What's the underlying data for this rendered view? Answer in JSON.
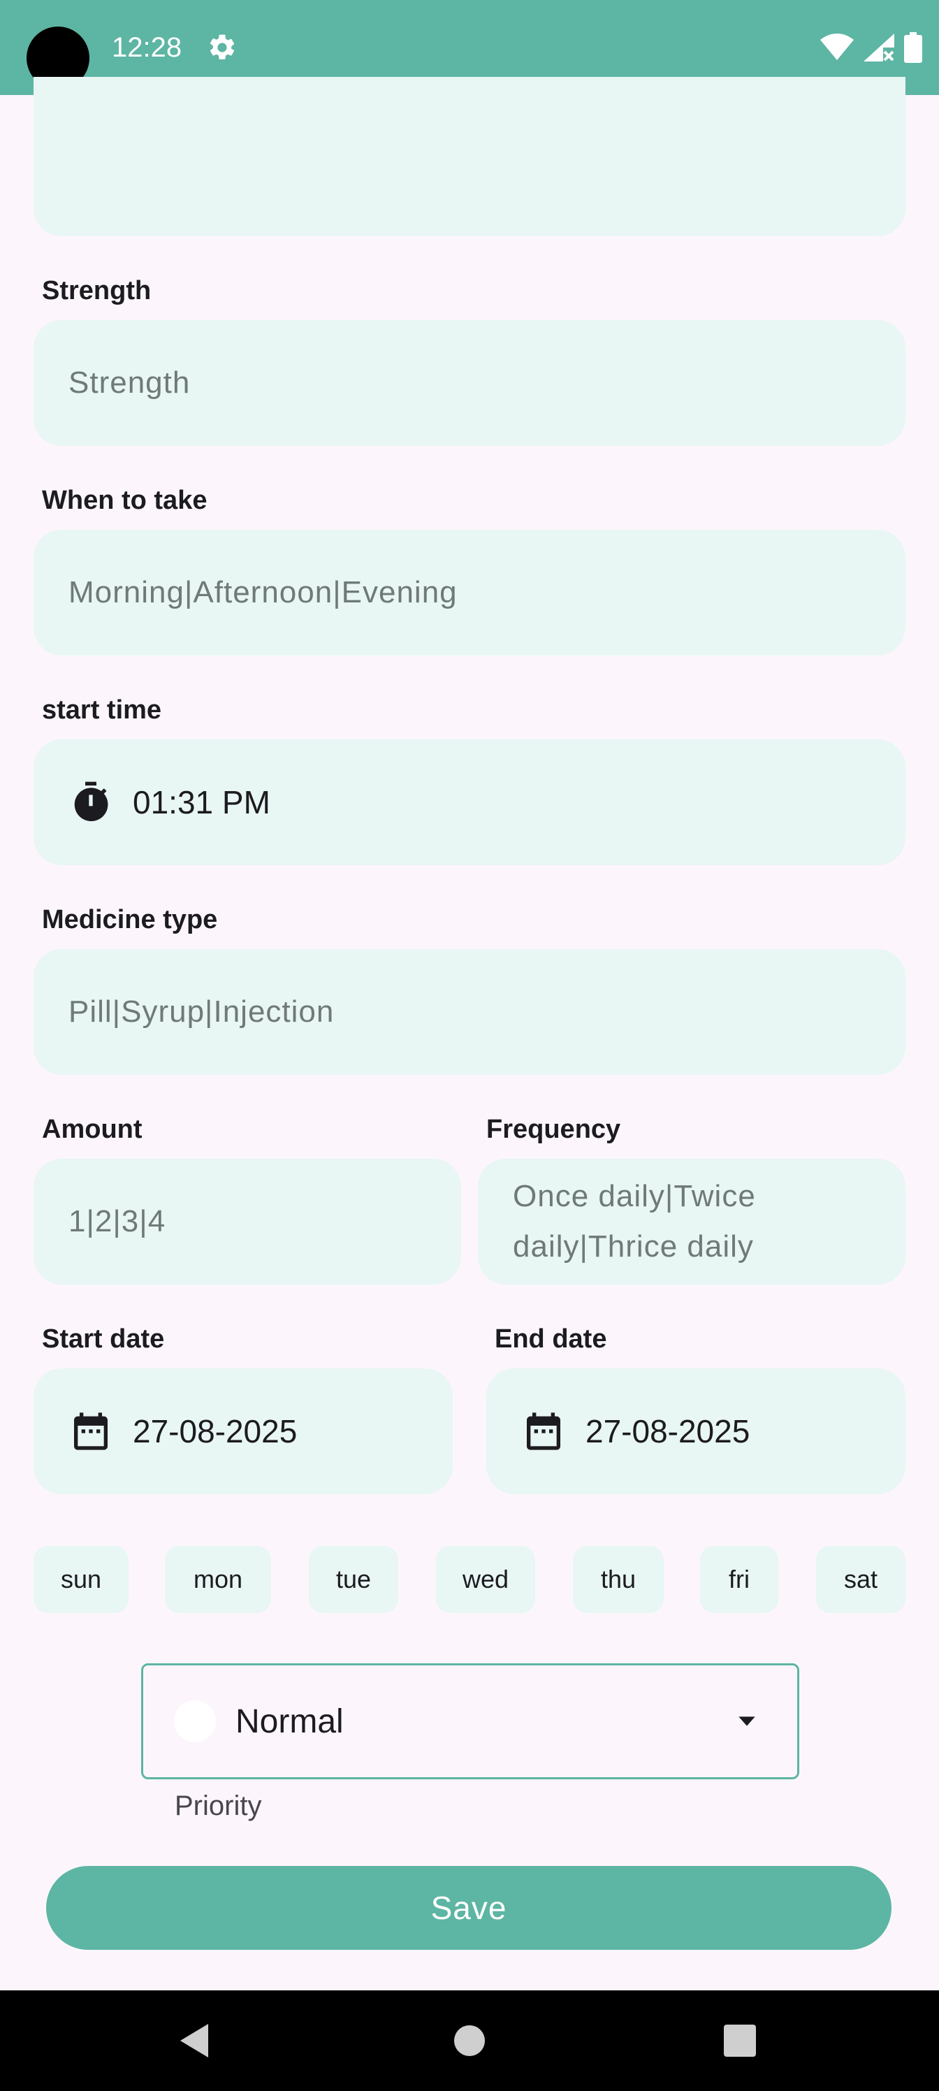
{
  "status_bar": {
    "time": "12:28",
    "icons": [
      "gear-icon",
      "wifi-icon",
      "signal-icon",
      "battery-icon"
    ]
  },
  "form": {
    "strength": {
      "label": "Strength",
      "placeholder": "Strength"
    },
    "when_to_take": {
      "label": "When to take",
      "placeholder": "Morning|Afternoon|Evening"
    },
    "start_time": {
      "label": "start time",
      "value": "01:31 PM"
    },
    "medicine_type": {
      "label": "Medicine type",
      "placeholder": "Pill|Syrup|Injection"
    },
    "amount": {
      "label": "Amount",
      "placeholder": "1|2|3|4"
    },
    "frequency": {
      "label": "Frequency",
      "placeholder_line1": "Once daily|Twice",
      "placeholder_line2": "daily|Thrice daily"
    },
    "start_date": {
      "label": "Start date",
      "value": "27-08-2025"
    },
    "end_date": {
      "label": "End date",
      "value": "27-08-2025"
    },
    "days": [
      "sun",
      "mon",
      "tue",
      "wed",
      "thu",
      "fri",
      "sat"
    ],
    "priority": {
      "value": "Normal",
      "label": "Priority"
    },
    "save_label": "Save"
  },
  "colors": {
    "accent": "#5db5a3",
    "field_bg": "#e8f6f4",
    "page_bg": "#fcf6fc"
  }
}
